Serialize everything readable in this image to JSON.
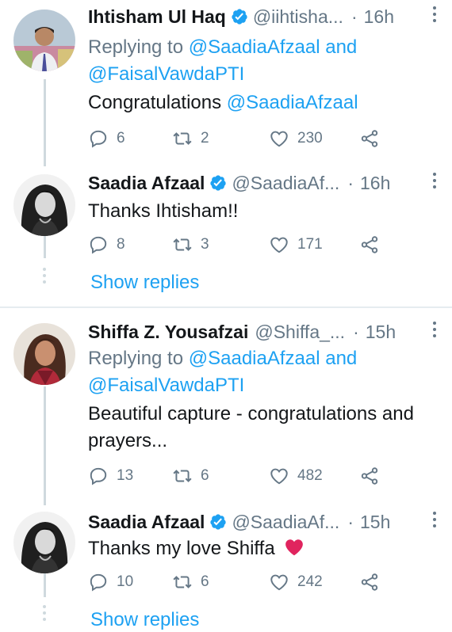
{
  "tweets": [
    {
      "name": "Ihtisham Ul Haq",
      "handle": "@iihtisha...",
      "time": "16h",
      "reply_prefix": "Replying to",
      "reply_handle1": "@SaadiaAfzaal",
      "reply_and": "and",
      "reply_handle2": "@FaisalVawdaPTI",
      "text_prefix": "Congratulations",
      "text_mention": "@SaadiaAfzaal",
      "replies": "6",
      "retweets": "2",
      "likes": "230"
    },
    {
      "name": "Saadia Afzaal",
      "handle": "@SaadiaAf...",
      "time": "16h",
      "text": "Thanks Ihtisham!!",
      "replies": "8",
      "retweets": "3",
      "likes": "171"
    },
    {
      "name": "Shiffa Z. Yousafzai",
      "handle": "@Shiffa_...",
      "time": "15h",
      "reply_prefix": "Replying to",
      "reply_handle1": "@SaadiaAfzaal",
      "reply_and": "and",
      "reply_handle2": "@FaisalVawdaPTI",
      "text": "Beautiful capture - congratulations and prayers...",
      "replies": "13",
      "retweets": "6",
      "likes": "482"
    },
    {
      "name": "Saadia Afzaal",
      "handle": "@SaadiaAf...",
      "time": "15h",
      "text": "Thanks my love Shiffa",
      "text_emoji": "heart-emoji",
      "replies": "10",
      "retweets": "6",
      "likes": "242"
    }
  ],
  "show_replies_label": "Show replies",
  "icons": [
    "verified-badge-icon",
    "reply-icon",
    "retweet-icon",
    "like-icon",
    "share-icon",
    "more-icon"
  ],
  "colors": {
    "link": "#1da1f2",
    "muted": "#657786",
    "verified": "#1da1f2",
    "heart": "#e0245e"
  }
}
